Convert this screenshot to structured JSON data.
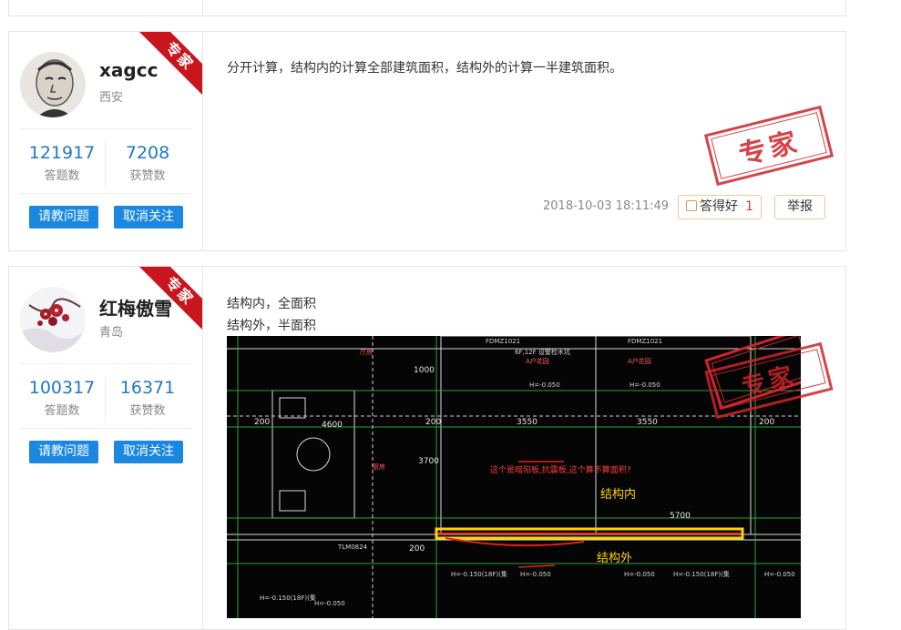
{
  "answers": [
    {
      "username": "xagcc",
      "location": "西安",
      "badge": "专家",
      "stats": {
        "answers_count": "121917",
        "answers_label": "答题数",
        "likes_count": "7208",
        "likes_label": "获赞数"
      },
      "buttons": {
        "ask": "请教问题",
        "unfollow": "取消关注"
      },
      "content": "分开计算，结构内的计算全部建筑面积，结构外的计算一半建筑面积。",
      "stamp": "专家",
      "timestamp": "2018-10-03 18:11:49",
      "good_label": "答得好",
      "good_count": "1",
      "report_label": "举报"
    },
    {
      "username": "红梅傲雪",
      "location": "青岛",
      "badge": "专家",
      "stats": {
        "answers_count": "100317",
        "answers_label": "答题数",
        "likes_count": "16371",
        "likes_label": "获赞数"
      },
      "buttons": {
        "ask": "请教问题",
        "unfollow": "取消关注"
      },
      "content_lines": [
        "结构内，全面积",
        "结构外，半面积"
      ],
      "stamp": "专家",
      "image": {
        "labels": {
          "inside": "结构内",
          "outside": "结构外",
          "question": "这个是暗阳板,抗震板,这个算不算面积?",
          "dims": [
            "4600",
            "3550",
            "3550",
            "200",
            "200",
            "200",
            "3700",
            "5700",
            "1000",
            "200"
          ],
          "room_labels": [
            "A户花园",
            "A户花园",
            "6F,12F 设警检木坑",
            "H=-0.050",
            "H=-0.050",
            "H=-0.150(18F)(集",
            "H=-0.050",
            "H=-0.050",
            "H=-0.050",
            "H=-0.150(18F)(集",
            "H=-0.150(18F)(集",
            "H=-0.050",
            "TLM0824",
            "FDMZ1021",
            "FDMZ1021",
            "厅房",
            "厨房"
          ]
        }
      }
    }
  ]
}
